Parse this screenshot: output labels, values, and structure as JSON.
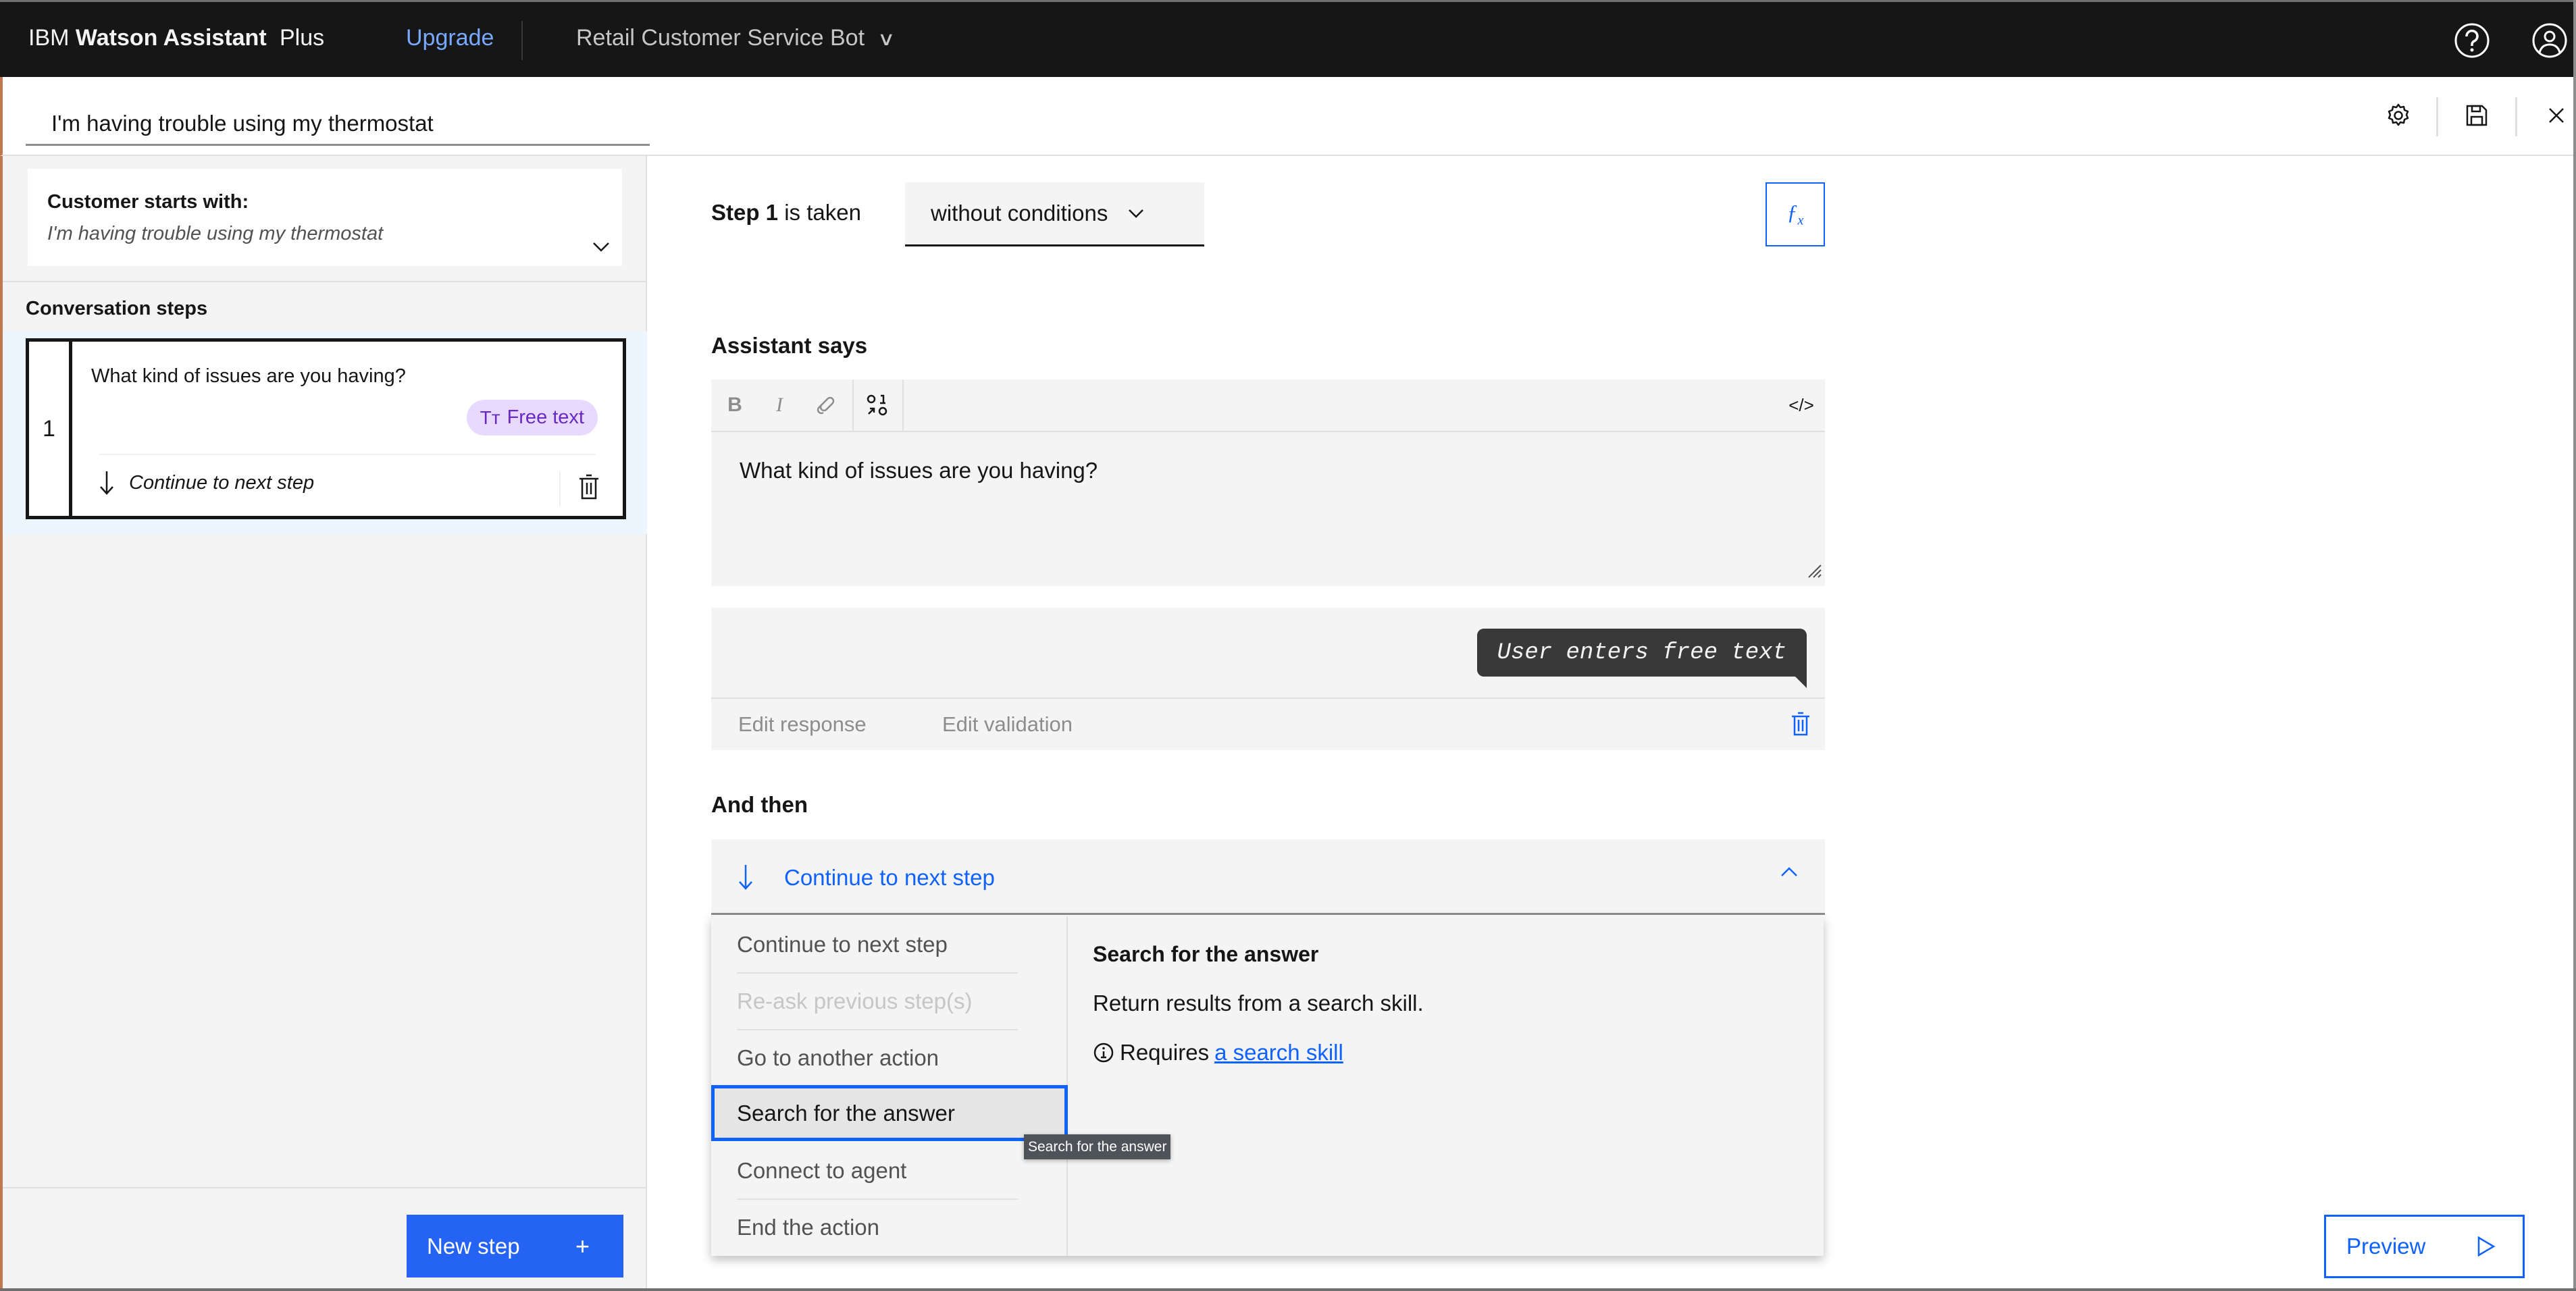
{
  "header": {
    "brand_prefix": "IBM",
    "brand_name": "Watson Assistant",
    "plan": "Plus",
    "upgrade_label": "Upgrade",
    "assistant_name": "Retail Customer Service Bot",
    "icons": [
      "help-icon",
      "user-profile-icon"
    ]
  },
  "action": {
    "title_value": "I'm having trouble using my thermostat",
    "toolbar_icons": [
      "settings-icon",
      "save-icon",
      "close-icon"
    ]
  },
  "sidebar": {
    "customer_starts_label": "Customer starts with:",
    "customer_starts_value": "I'm having trouble using my thermostat",
    "conversation_steps_label": "Conversation steps",
    "steps": [
      {
        "number": "1",
        "question": "What kind of issues are you having?",
        "response_type": "Free text",
        "next": "Continue to next step"
      }
    ],
    "new_step_label": "New step",
    "new_step_icon": "+"
  },
  "editor": {
    "step_prefix": "Step 1",
    "step_suffix": "is taken",
    "condition_value": "without conditions",
    "fx_label": "fx",
    "assistant_says_label": "Assistant says",
    "rte_buttons": [
      "B",
      "I",
      "link",
      "variable"
    ],
    "rte_source_label": "</>",
    "assistant_text": "What kind of issues are you having?",
    "user_bubble": "User enters free text",
    "edit_response_label": "Edit response",
    "edit_validation_label": "Edit validation",
    "and_then_label": "And then",
    "and_then_value": "Continue to next step",
    "menu_items": [
      {
        "label": "Continue to next step",
        "state": "normal"
      },
      {
        "label": "Re-ask previous step(s)",
        "state": "disabled"
      },
      {
        "label": "Go to another action",
        "state": "normal"
      },
      {
        "label": "Search for the answer",
        "state": "active"
      },
      {
        "label": "Connect to agent",
        "state": "normal"
      },
      {
        "label": "End the action",
        "state": "normal"
      }
    ],
    "detail_title": "Search for the answer",
    "detail_text": "Return results from a search skill.",
    "detail_requires": "Requires",
    "detail_link": "a search skill",
    "tooltip": "Search for the answer",
    "preview_label": "Preview"
  },
  "colors": {
    "accent": "#0f62fe",
    "header_bg": "#161616",
    "tag_bg": "#e8daff",
    "tag_fg": "#6929c4",
    "link_header": "#78a9ff"
  }
}
